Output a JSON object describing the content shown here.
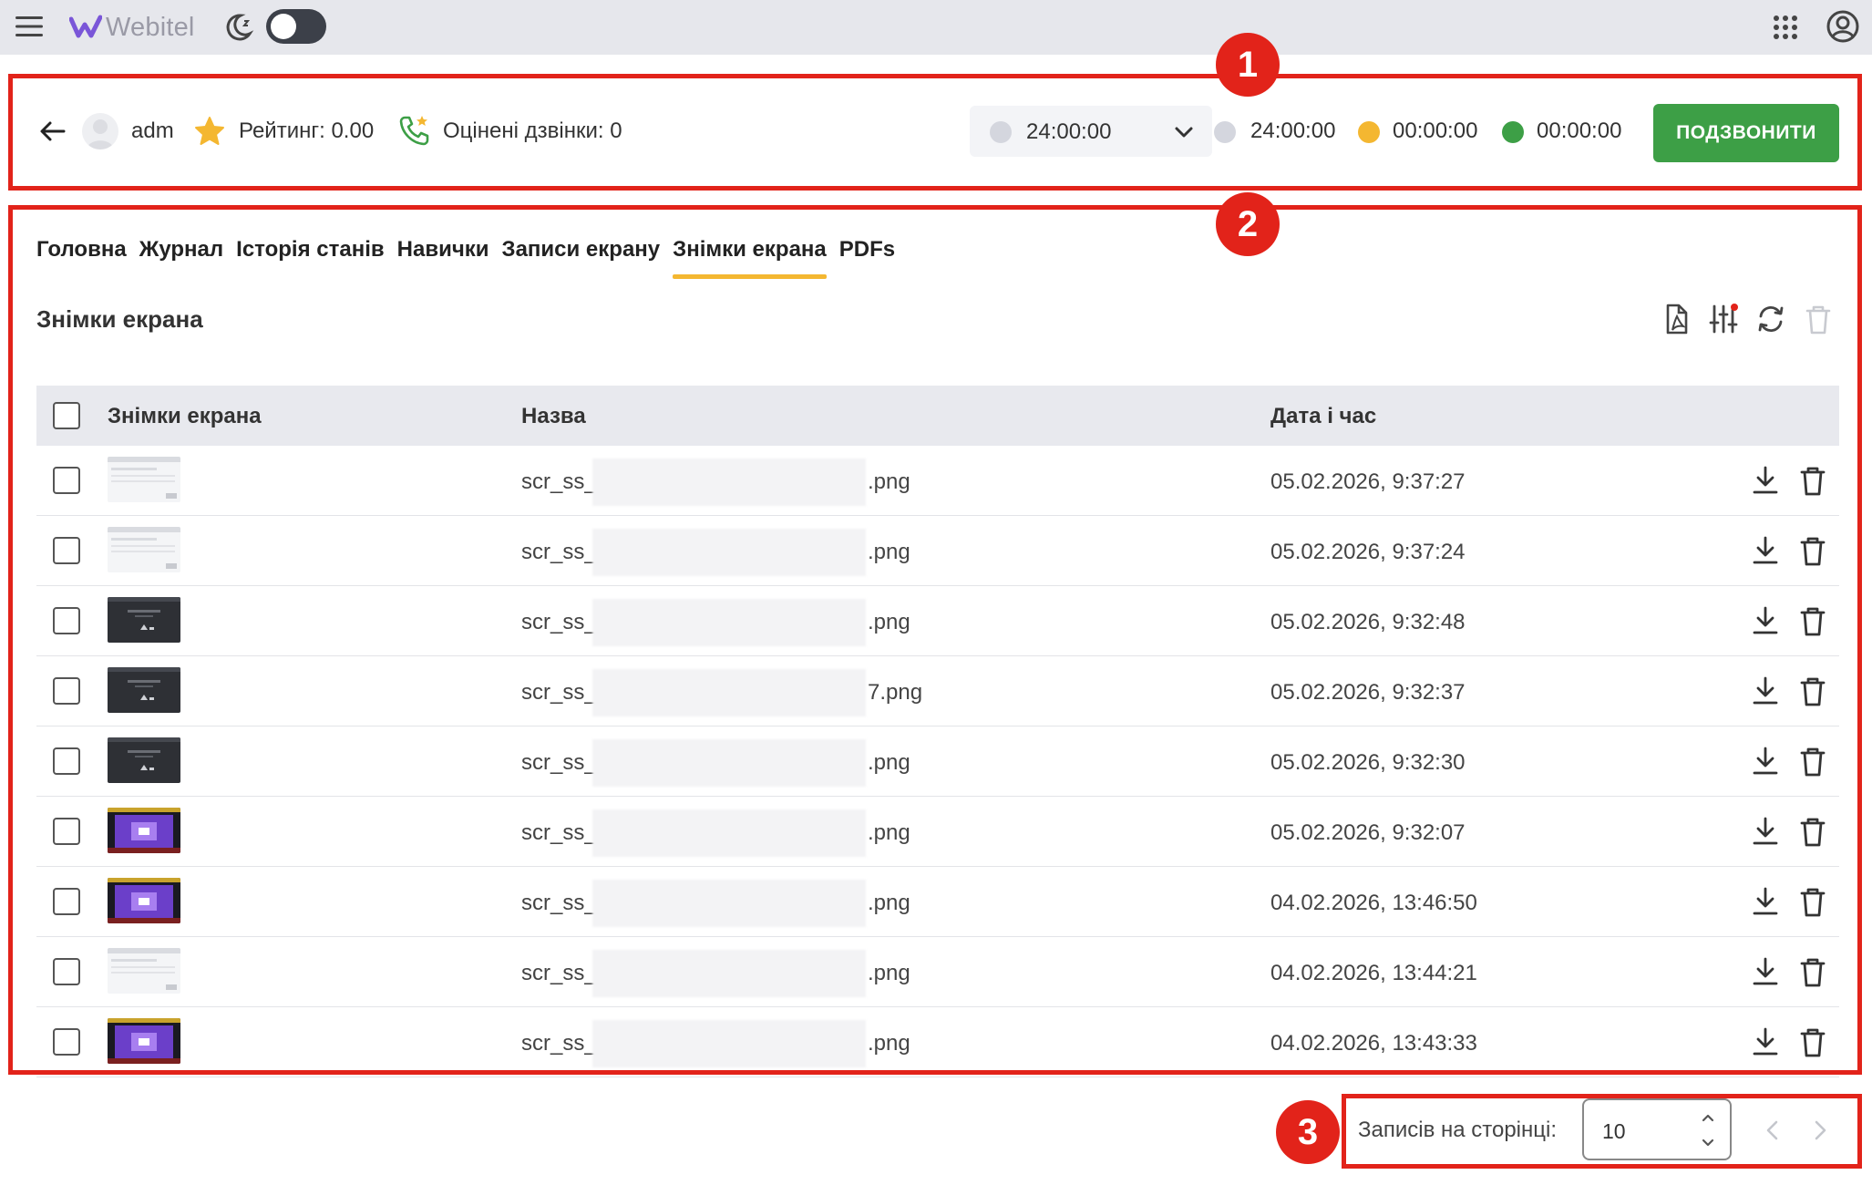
{
  "app": {
    "brand": "Webitel",
    "icons": [
      "menu-icon",
      "moon-icon",
      "apps-grid-icon",
      "account-icon"
    ]
  },
  "agent": {
    "name": "adm",
    "rating_label": "Рейтинг: 0.00",
    "rated_calls_label": "Оцінені дзвінки: 0",
    "status_time": "24:00:00",
    "timers": [
      {
        "color": "#d4d6de",
        "value": "24:00:00"
      },
      {
        "color": "#f4b731",
        "value": "00:00:00"
      },
      {
        "color": "#3d9f46",
        "value": "00:00:00"
      }
    ],
    "call_button": "ПОДЗВОНИТИ"
  },
  "tabs": [
    "Головна",
    "Журнал",
    "Історія станів",
    "Навички",
    "Записи екрану",
    "Знімки екрана",
    "PDFs"
  ],
  "active_tab": 5,
  "section_title": "Знімки екрана",
  "table": {
    "headers": {
      "thumb": "Знімки екрана",
      "name": "Назва",
      "date": "Дата і час"
    },
    "rows": [
      {
        "name_start": "scr_ss_",
        "name_end": ".png",
        "date": "05.02.2026, 9:37:27",
        "thumb": "light"
      },
      {
        "name_start": "scr_ss_",
        "name_end": ".png",
        "date": "05.02.2026, 9:37:24",
        "thumb": "light"
      },
      {
        "name_start": "scr_ss_",
        "name_end": ".png",
        "date": "05.02.2026, 9:32:48",
        "thumb": "dark"
      },
      {
        "name_start": "scr_ss_",
        "name_end": "7.png",
        "date": "05.02.2026, 9:32:37",
        "thumb": "dark"
      },
      {
        "name_start": "scr_ss_",
        "name_end": ".png",
        "date": "05.02.2026, 9:32:30",
        "thumb": "dark"
      },
      {
        "name_start": "scr_ss_",
        "name_end": ".png",
        "date": "05.02.2026, 9:32:07",
        "thumb": "purple"
      },
      {
        "name_start": "scr_ss_",
        "name_end": ".png",
        "date": "04.02.2026, 13:46:50",
        "thumb": "purple"
      },
      {
        "name_start": "scr_ss_",
        "name_end": ".png",
        "date": "04.02.2026, 13:44:21",
        "thumb": "light"
      },
      {
        "name_start": "scr_ss_",
        "name_end": ".png",
        "date": "04.02.2026, 13:43:33",
        "thumb": "purple"
      }
    ]
  },
  "pagination": {
    "label": "Записів на сторінці:",
    "per_page": "10"
  },
  "annotations": [
    "1",
    "2",
    "3"
  ],
  "colors": {
    "accent": "#f4b731",
    "call_button": "#3d9f46",
    "annotation": "#e2231a",
    "topbar": "#e6e7ec"
  }
}
